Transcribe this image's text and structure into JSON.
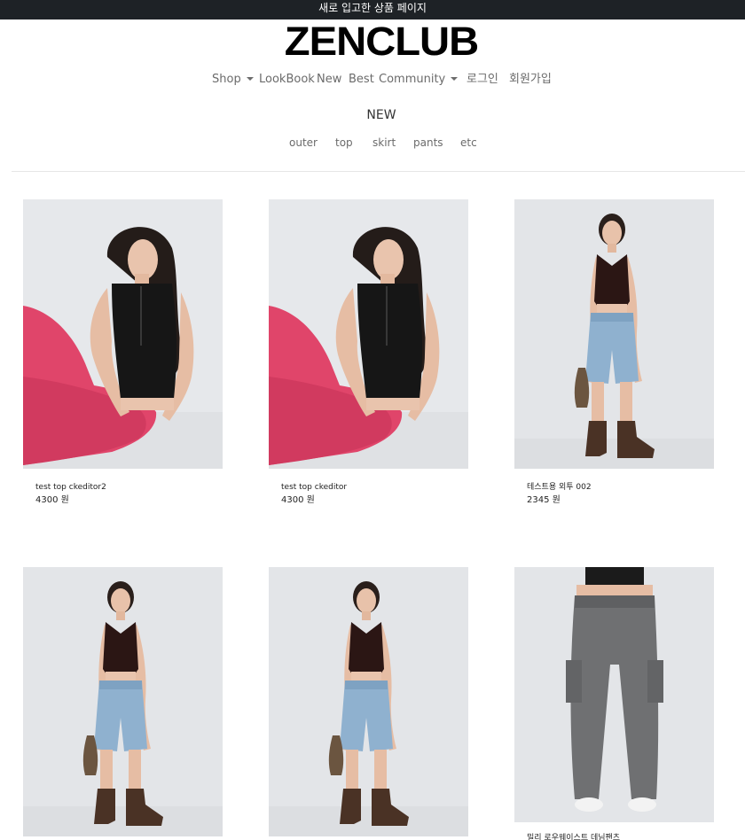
{
  "announcement": "새로 입고한 상품 페이지",
  "brand": {
    "logo_text": "ZENCLUB"
  },
  "nav": {
    "items": [
      {
        "label": "Shop",
        "dropdown": true
      },
      {
        "label": "LookBook",
        "dropdown": false
      },
      {
        "label": "New",
        "dropdown": false
      },
      {
        "label": "Best",
        "dropdown": false
      },
      {
        "label": "Community",
        "dropdown": true
      }
    ],
    "login": "로그인",
    "signup": "회원가입"
  },
  "section": {
    "title": "NEW",
    "categories": [
      "outer",
      "top",
      "skirt",
      "pants",
      "etc"
    ]
  },
  "products": [
    {
      "name": "test top ckeditor2",
      "price": "4300 원",
      "image": "sitting-black-top-pink-pants"
    },
    {
      "name": "test top ckeditor",
      "price": "4300 원",
      "image": "sitting-black-top-pink-pants"
    },
    {
      "name": "테스트용 외투 002",
      "price": "2345 원",
      "image": "halter-top-denim-shorts"
    },
    {
      "name": "",
      "price": "",
      "image": "halter-top-denim-shorts"
    },
    {
      "name": "",
      "price": "",
      "image": "halter-top-denim-shorts"
    },
    {
      "name": "밀리 로우웨이스트 데님팬츠",
      "price": "",
      "image": "grey-cargo-pants"
    }
  ],
  "colors": {
    "topbar_bg": "#1e2226",
    "image_bg": "#e9ebee",
    "pink": "#e0456a",
    "denim": "#8fb1cf"
  }
}
